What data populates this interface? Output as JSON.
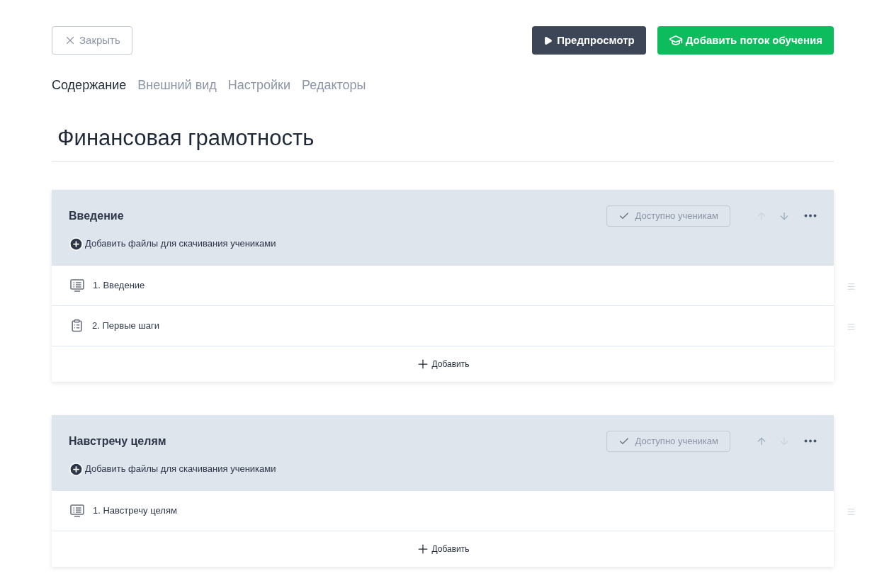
{
  "close_button": {
    "label": "Закрыть"
  },
  "preview_button": {
    "label": "Предпросмотр"
  },
  "add_stream_button": {
    "label": "Добавить поток обучения"
  },
  "tabs": [
    {
      "label": "Содержание",
      "selected": true
    },
    {
      "label": "Внешний вид",
      "selected": false
    },
    {
      "label": "Настройки",
      "selected": false
    },
    {
      "label": "Редакторы",
      "selected": false
    }
  ],
  "course_title": "Финансовая грамотность",
  "sections": [
    {
      "title": "Введение",
      "available_label": "Доступно ученикам",
      "move_up_disabled": true,
      "move_down_disabled": false,
      "add_files_label": "Добавить файлы для скачивания учениками",
      "lessons": [
        {
          "kind": "lecture",
          "label": "1. Введение"
        },
        {
          "kind": "task",
          "label": "2. Первые шаги"
        }
      ],
      "add_label": "Добавить"
    },
    {
      "title": "Навстречу целям",
      "available_label": "Доступно ученикам",
      "move_up_disabled": false,
      "move_down_disabled": true,
      "add_files_label": "Добавить файлы для скачивания учениками",
      "lessons": [
        {
          "kind": "lecture",
          "label": "1. Навстречу целям"
        }
      ],
      "add_label": "Добавить"
    }
  ]
}
